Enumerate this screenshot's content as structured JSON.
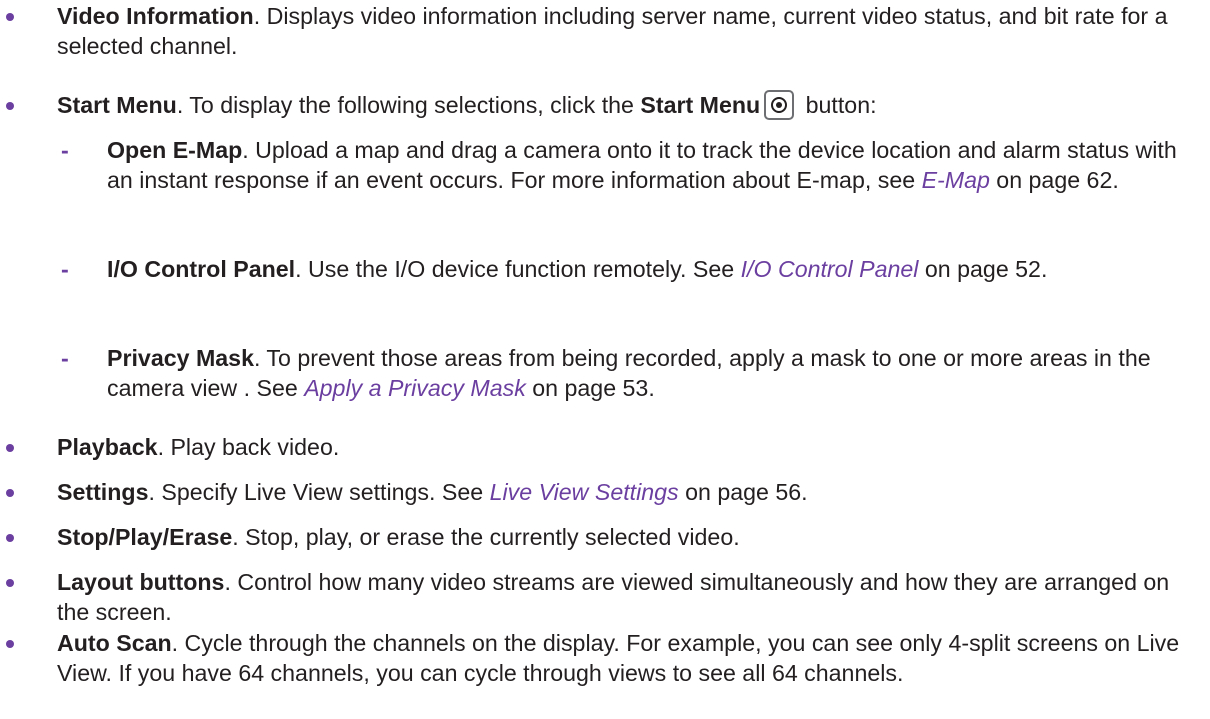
{
  "colors": {
    "accent": "#6b3fa0",
    "text": "#231f20"
  },
  "items": [
    {
      "term": "Video Information",
      "text": ". Displays video information including server name, current video status, and bit rate for a selected channel."
    },
    {
      "term": "Start Menu",
      "text_before": ". To display the following selections, click the ",
      "button_name": "Start Menu",
      "icon": "record-button-icon",
      "text_after": " button:"
    },
    {
      "term": "Open E-Map",
      "text": ". Upload a map and drag a camera onto it to track the device location and alarm status with an instant response if an event occurs. For more information about E-map, see ",
      "link": "E-Map",
      "tail": " on page 62."
    },
    {
      "term": "I/O Control Panel",
      "text": ". Use the I/O device function remotely. See ",
      "link": "I/O Control Panel",
      "tail": " on page 52."
    },
    {
      "term": "Privacy Mask",
      "text": ". To prevent those areas from being recorded, apply a mask to one or more areas in the camera view . See ",
      "link": "Apply a Privacy Mask",
      "tail": " on page 53."
    },
    {
      "term": "Playback",
      "text": ". Play back video."
    },
    {
      "term": "Settings",
      "text": ". Specify Live View settings. See ",
      "link": "Live View Settings",
      "tail": " on page 56."
    },
    {
      "term": "Stop/Play/Erase",
      "text": ". Stop, play, or erase the currently selected video."
    },
    {
      "term": "Layout buttons",
      "text": ". Control how many video streams are viewed simultaneously and how they are arranged on the screen."
    },
    {
      "term": "Auto Scan",
      "text": ". Cycle through the channels on the display. For example, you can see only 4-split screens on Live View. If you have 64 channels, you can cycle through views to see all 64 channels."
    }
  ]
}
